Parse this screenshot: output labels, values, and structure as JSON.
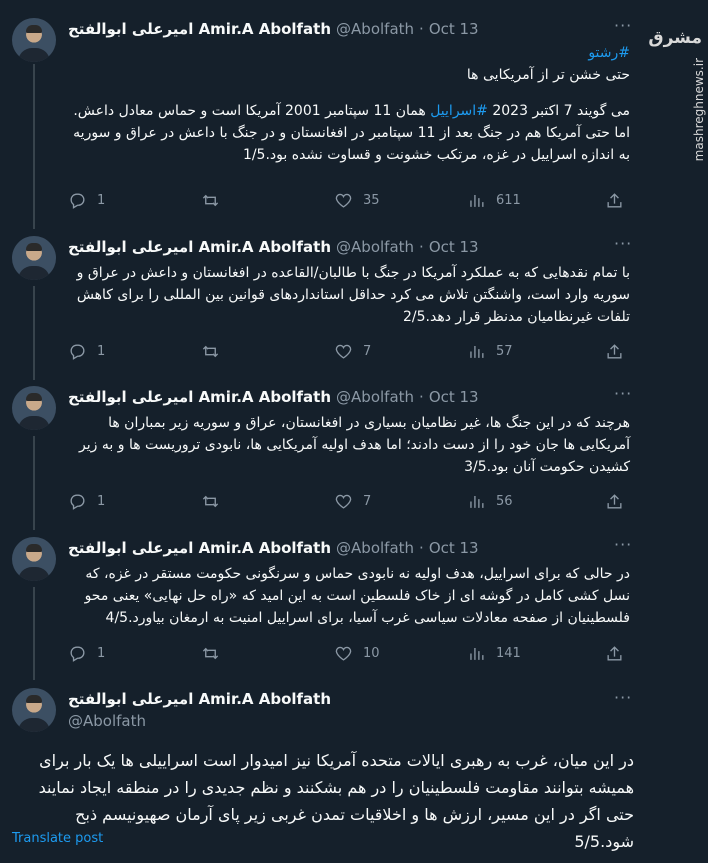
{
  "author": {
    "display_name": "امیرعلی ابوالفتح Amir.A Abolfath",
    "handle": "@Abolfath",
    "separator": "·",
    "date": "Oct 13"
  },
  "watermark": {
    "logo": "مشرق",
    "url": "mashreghnews.ir"
  },
  "tweets": [
    {
      "hashtag": "#رشتو",
      "line_a": "حتی خشن تر از آمریکایی ها",
      "p2_pre": "می گویند 7 اکتبر 2023 ",
      "p2_link": "#اسراییل",
      "p2_post": " همان 11 سپتامبر 2001 آمریکا است و حماس معادل داعش.",
      "p3": "اما حتی آمریکا هم در جنگ بعد از 11 سپتامبر در افغانستان و در جنگ با داعش در عراق و سوریه به اندازه اسراییل در غزه، مرتکب خشونت و قساوت نشده بود.1/5",
      "replies": "1",
      "retweets": "",
      "likes": "35",
      "views": "611"
    },
    {
      "text": "با تمام نقدهایی که به عملکرد آمریکا در جنگ با طالبان/القاعده در افغانستان و داعش در عراق و سوریه وارد است، واشنگتن تلاش می کرد حداقل استانداردهای قوانین بین المللی را برای کاهش تلفات غیرنظامیان مدنظر قرار دهد.2/5",
      "replies": "1",
      "retweets": "",
      "likes": "7",
      "views": "57"
    },
    {
      "text": "هرچند که در این جنگ ها، غیر نظامیان بسیاری در افغانستان، عراق و سوریه زیر بمباران ها آمریکایی ها جان خود را از دست دادند؛ اما هدف اولیه آمریکایی ها، نابودی تروریست ها و به زیر کشیدن حکومت آنان بود.3/5",
      "replies": "1",
      "retweets": "",
      "likes": "7",
      "views": "56"
    },
    {
      "text": "در حالی که برای اسراییل، هدف اولیه نه نابودی حماس و سرنگونی حکومت مستقر در غزه، که نسل کشی کامل در گوشه ای از خاک فلسطین است به این امید که «راه حل نهایی» یعنی محو فلسطینیان از صفحه معادلات سیاسی غرب آسیا، برای اسراییل امنیت به ارمغان بیاورد.4/5",
      "replies": "1",
      "retweets": "",
      "likes": "10",
      "views": "141"
    }
  ],
  "last_tweet": {
    "text": "در این میان، غرب به رهبری ایالات متحده آمریکا نیز امیدوار است اسراییلی ها یک بار برای همیشه بتوانند مقاومت فلسطینیان را در هم بشکنند و نظم جدیدی را در منطقه ایجاد نمایند حتی اگر در این مسیر، ارزش ها و اخلاقیات تمدن غربی زیر پای آرمان صهیونیسم ذبح شود.5/5",
    "translate": "Translate post"
  }
}
